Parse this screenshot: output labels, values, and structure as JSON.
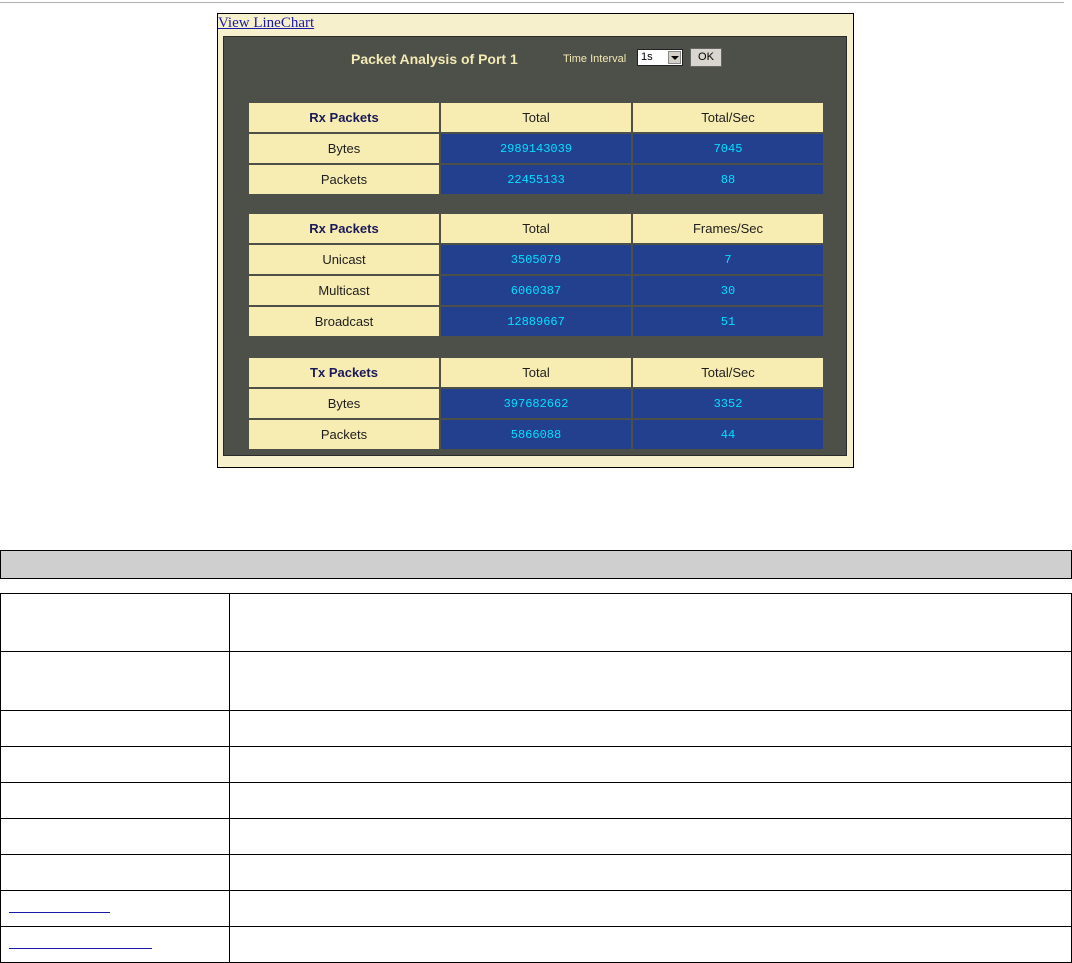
{
  "link": {
    "view_linechart": "View LineChart"
  },
  "panel": {
    "title": "Packet Analysis of Port 1",
    "time_interval_label": "Time Interval",
    "time_interval_value": "1s",
    "ok_label": "OK"
  },
  "rx_bytes_table": {
    "headers": [
      "Rx Packets",
      "Total",
      "Total/Sec"
    ],
    "rows": [
      {
        "label": "Bytes",
        "total": "2989143039",
        "rate": "7045"
      },
      {
        "label": "Packets",
        "total": "22455133",
        "rate": "88"
      }
    ]
  },
  "rx_frames_table": {
    "headers": [
      "Rx Packets",
      "Total",
      "Frames/Sec"
    ],
    "rows": [
      {
        "label": "Unicast",
        "total": "3505079",
        "rate": "7"
      },
      {
        "label": "Multicast",
        "total": "6060387",
        "rate": "30"
      },
      {
        "label": "Broadcast",
        "total": "12889667",
        "rate": "51"
      }
    ]
  },
  "tx_table": {
    "headers": [
      "Tx Packets",
      "Total",
      "Total/Sec"
    ],
    "rows": [
      {
        "label": "Bytes",
        "total": "397682662",
        "rate": "3352"
      },
      {
        "label": "Packets",
        "total": "5866088",
        "rate": "44"
      }
    ]
  },
  "colors": {
    "panel_bg": "#4d4f49",
    "header_cell": "#f7ecb1",
    "value_cell": "#23408f",
    "value_text": "#00e0ff",
    "title_text": "#f4eab4"
  }
}
